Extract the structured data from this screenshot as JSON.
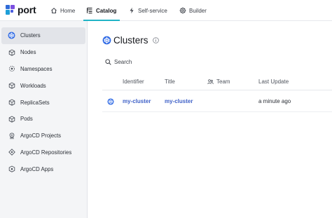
{
  "brand": {
    "name": "port"
  },
  "topnav": {
    "items": [
      {
        "label": "Home",
        "icon": "home-icon"
      },
      {
        "label": "Catalog",
        "icon": "catalog-icon",
        "active": true
      },
      {
        "label": "Self-service",
        "icon": "lightning-icon"
      },
      {
        "label": "Builder",
        "icon": "gear-icon"
      }
    ]
  },
  "sidebar": {
    "items": [
      {
        "label": "Clusters",
        "icon": "kubernetes-icon",
        "active": true
      },
      {
        "label": "Nodes",
        "icon": "cube-icon"
      },
      {
        "label": "Namespaces",
        "icon": "namespace-icon"
      },
      {
        "label": "Workloads",
        "icon": "cube-icon"
      },
      {
        "label": "ReplicaSets",
        "icon": "cube-icon"
      },
      {
        "label": "Pods",
        "icon": "cube-icon"
      },
      {
        "label": "ArgoCD Projects",
        "icon": "argocd-icon"
      },
      {
        "label": "ArgoCD Repositories",
        "icon": "argocd-repo-icon"
      },
      {
        "label": "ArgoCD Apps",
        "icon": "argocd-app-icon"
      }
    ]
  },
  "page": {
    "title": "Clusters",
    "search_label": "Search"
  },
  "table": {
    "columns": [
      "Identifier",
      "Title",
      "Team",
      "Last Update"
    ],
    "rows": [
      {
        "identifier": "my-cluster",
        "title": "my-cluster",
        "team": "",
        "last_update": "a minute ago"
      }
    ]
  },
  "colors": {
    "accent": "#21b4c6",
    "link": "#3d5fc7",
    "kubernetes": "#326ce5",
    "sidebar_bg": "#f4f5f7"
  }
}
